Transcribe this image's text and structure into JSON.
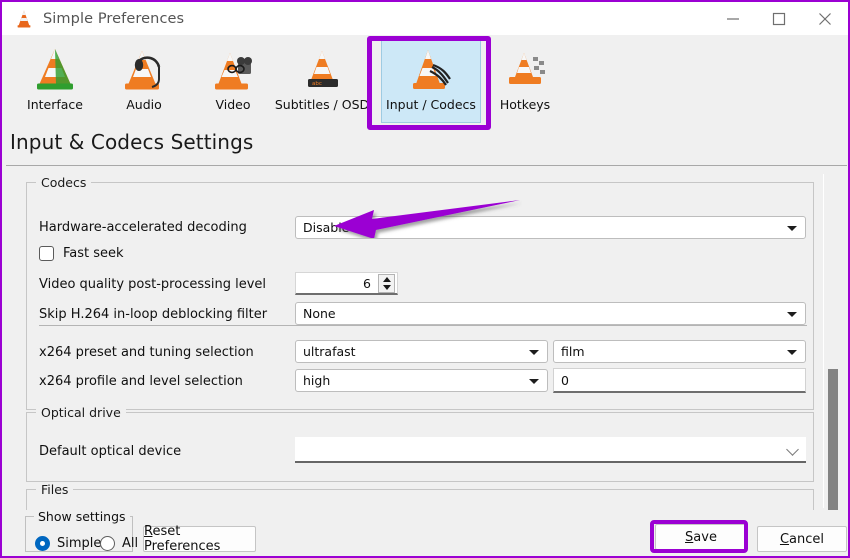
{
  "window": {
    "title": "Simple Preferences",
    "app_icon": "vlc-cone-icon",
    "controls": {
      "minimize": "minimize-icon",
      "maximize": "maximize-icon",
      "close": "close-icon"
    }
  },
  "toolbar": {
    "items": [
      {
        "label": "Interface",
        "icon": "vlc-cone-interface-icon",
        "selected": false
      },
      {
        "label": "Audio",
        "icon": "vlc-cone-audio-icon",
        "selected": false
      },
      {
        "label": "Video",
        "icon": "vlc-cone-video-icon",
        "selected": false
      },
      {
        "label": "Subtitles / OSD",
        "icon": "vlc-cone-subtitles-icon",
        "selected": false
      },
      {
        "label": "Input / Codecs",
        "icon": "vlc-cone-input-codecs-icon",
        "selected": true
      },
      {
        "label": "Hotkeys",
        "icon": "vlc-cone-hotkeys-icon",
        "selected": false
      }
    ]
  },
  "page": {
    "title": "Input & Codecs Settings"
  },
  "codecs": {
    "group_title": "Codecs",
    "hw_decoding": {
      "label": "Hardware-accelerated decoding",
      "value": "Disable"
    },
    "fast_seek": {
      "label": "Fast seek",
      "checked": false
    },
    "post_processing": {
      "label": "Video quality post-processing level",
      "value": "6"
    },
    "deblocking": {
      "label": "Skip H.264 in-loop deblocking filter",
      "value": "None"
    },
    "x264_preset": {
      "label": "x264 preset and tuning selection",
      "preset_value": "ultrafast",
      "tuning_value": "film"
    },
    "x264_profile": {
      "label": "x264 profile and level selection",
      "profile_value": "high",
      "level_value": "0"
    }
  },
  "optical_drive": {
    "group_title": "Optical drive",
    "default_device": {
      "label": "Default optical device",
      "value": ""
    }
  },
  "files": {
    "group_title": "Files"
  },
  "bottom": {
    "show_settings": {
      "group_title": "Show settings",
      "options": [
        {
          "label": "Simple",
          "selected": true
        },
        {
          "label": "All",
          "selected": false
        }
      ]
    },
    "reset_button": "Reset Preferences",
    "save_button": "Save",
    "cancel_button": "Cancel"
  },
  "annotations": {
    "arrow_color": "#9b00d3",
    "highlight_color": "#9b00d3",
    "arrow_target": "Disable",
    "highlighted_elements": [
      "Input / Codecs",
      "Save"
    ]
  },
  "colors": {
    "window_border": "#9b00d3",
    "background": "#f0f0f0",
    "titlebar": "#ffffff",
    "selected_tab_bg": "#cde8f7",
    "radio_accent": "#0067c0",
    "scrollbar_thumb": "#838383"
  }
}
